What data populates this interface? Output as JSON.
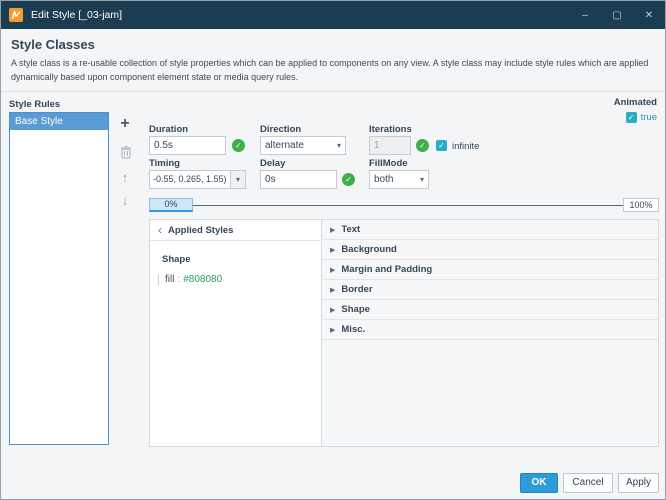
{
  "window": {
    "title": "Edit Style [_03-jam]"
  },
  "icons": {
    "add": "+",
    "up": "↑",
    "down": "↓",
    "collapsed": "▶",
    "back": "‹",
    "caret": "▾",
    "check": "✓",
    "minimize": "–",
    "maximize": "▢",
    "close": "✕"
  },
  "header": {
    "title": "Style Classes",
    "description": "A style class is a re-usable collection of style properties which can be applied to components on any view. A style class may include style rules which are applied dynamically based upon component element state or media query rules."
  },
  "style_rules": {
    "label": "Style Rules",
    "items": [
      {
        "label": "Base Style"
      }
    ]
  },
  "animated": {
    "label": "Animated",
    "value": "true"
  },
  "form": {
    "duration": {
      "label": "Duration",
      "value": "0.5s"
    },
    "direction": {
      "label": "Direction",
      "value": "alternate"
    },
    "iterations": {
      "label": "Iterations",
      "value": "1",
      "infinite_label": "infinite"
    },
    "timing": {
      "label": "Timing",
      "value": "-0.55, 0.265, 1.55)"
    },
    "delay": {
      "label": "Delay",
      "value": "0s"
    },
    "fillmode": {
      "label": "FillMode",
      "value": "both"
    }
  },
  "timeline": {
    "start": "0%",
    "end": "100%"
  },
  "applied_styles": {
    "header": "Applied Styles",
    "group": "Shape",
    "property": {
      "name": "fill",
      "separator": ":",
      "value": "#808080"
    }
  },
  "style_categories": [
    {
      "label": "Text"
    },
    {
      "label": "Background"
    },
    {
      "label": "Margin and Padding"
    },
    {
      "label": "Border"
    },
    {
      "label": "Shape"
    },
    {
      "label": "Misc."
    }
  ],
  "footer": {
    "ok": "OK",
    "cancel": "Cancel",
    "apply": "Apply"
  },
  "colors": {
    "titlebar": "#1c3c52",
    "accent": "#2d9cdb",
    "selection": "#5b9bd5",
    "valid_green": "#3fae49",
    "checkbox_teal": "#2bacc4",
    "value_green": "#2aa05e"
  }
}
